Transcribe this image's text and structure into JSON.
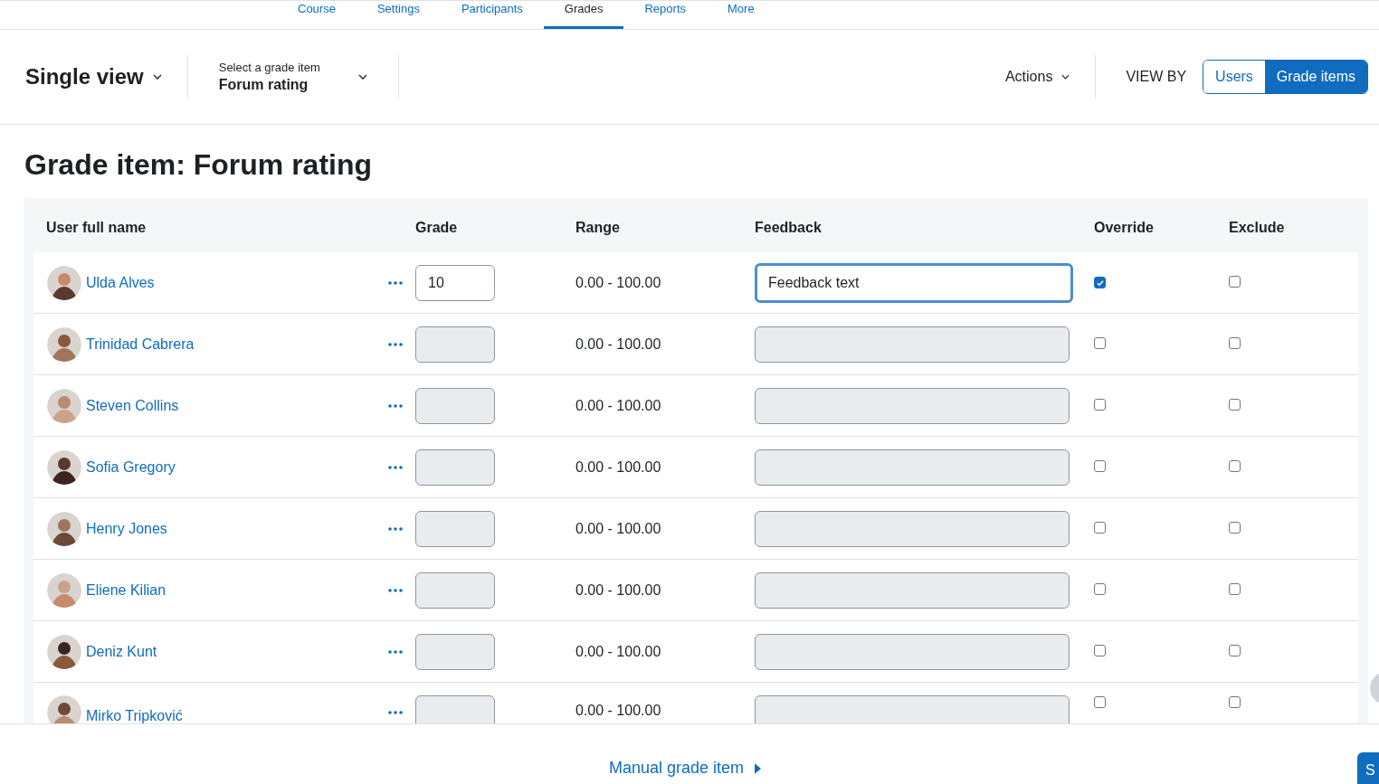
{
  "nav_tabs": [
    {
      "label": "Course",
      "selected": false
    },
    {
      "label": "Settings",
      "selected": false
    },
    {
      "label": "Participants",
      "selected": false
    },
    {
      "label": "Grades",
      "selected": true
    },
    {
      "label": "Reports",
      "selected": false
    },
    {
      "label": "More",
      "selected": false
    }
  ],
  "header": {
    "view_menu": "Single view",
    "item_selector": {
      "label": "Select a grade item",
      "value": "Forum rating"
    },
    "actions": "Actions",
    "view_by_label": "VIEW BY",
    "view_by": [
      {
        "label": "Users",
        "selected": false
      },
      {
        "label": "Grade items",
        "selected": true
      }
    ]
  },
  "title": "Grade item: Forum rating",
  "table": {
    "columns": [
      "User full name",
      "Grade",
      "Range",
      "Feedback",
      "Override",
      "Exclude"
    ],
    "rows": [
      {
        "name": "Ulda Alves",
        "grade": "10",
        "range": "0.00 - 100.00",
        "feedback": "Feedback text",
        "override": true,
        "exclude": false
      },
      {
        "name": "Trinidad Cabrera",
        "range": "0.00 - 100.00",
        "override": false,
        "exclude": false
      },
      {
        "name": "Steven Collins",
        "range": "0.00 - 100.00",
        "override": false,
        "exclude": false
      },
      {
        "name": "Sofia Gregory",
        "range": "0.00 - 100.00",
        "override": false,
        "exclude": false
      },
      {
        "name": "Henry Jones",
        "range": "0.00 - 100.00",
        "override": false,
        "exclude": false
      },
      {
        "name": "Eliene Kilian",
        "range": "0.00 - 100.00",
        "override": false,
        "exclude": false
      },
      {
        "name": "Deniz Kunt",
        "range": "0.00 - 100.00",
        "override": false,
        "exclude": false
      },
      {
        "name": "Mirko Tripković",
        "range": "0.00 - 100.00",
        "override": false,
        "exclude": false
      }
    ]
  },
  "footer": {
    "link": "Manual grade item",
    "save_button": "S"
  }
}
